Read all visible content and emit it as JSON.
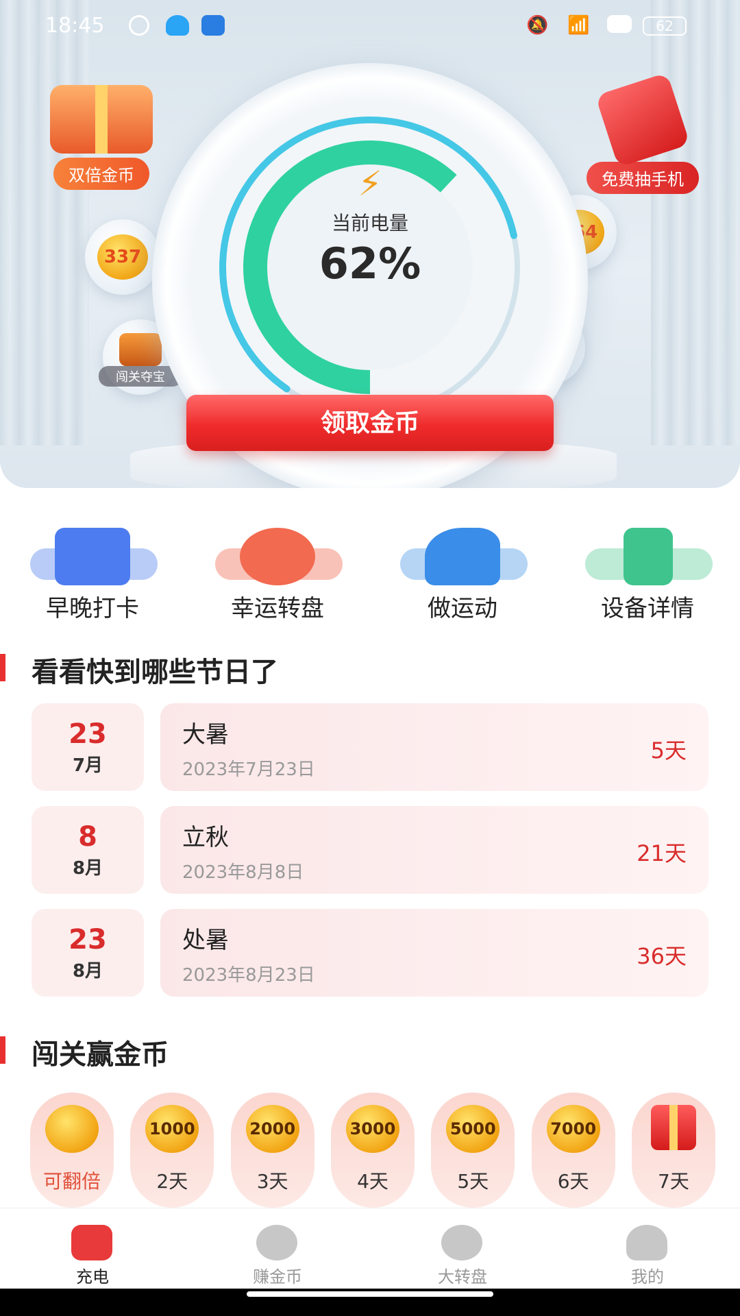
{
  "status_bar": {
    "time": "18:45",
    "battery": "62"
  },
  "hero": {
    "battery_label": "当前电量",
    "battery_percent": "62%",
    "battery_level": 0.62,
    "left_badge": "双倍金币",
    "right_badge": "免费抽手机",
    "coin_left": "337",
    "coin_right": "364",
    "chest_label": "闯关夺宝",
    "claim_button": "领取金币",
    "accent_color": "#e83030",
    "gauge_color": "#2fd1a0"
  },
  "actions": [
    {
      "label": "早晚打卡",
      "icon": "calendar-check-icon",
      "color": "#4d7cf0",
      "base": "#b9ccf7"
    },
    {
      "label": "幸运转盘",
      "icon": "lucky-wheel-icon",
      "color": "#f26a50",
      "base": "#f9c2b8"
    },
    {
      "label": "做运动",
      "icon": "sneaker-icon",
      "color": "#3a8de8",
      "base": "#b6d5f5"
    },
    {
      "label": "设备详情",
      "icon": "phone-device-icon",
      "color": "#3fc48e",
      "base": "#bdebd6"
    }
  ],
  "holidays_section": {
    "title": "看看快到哪些节日了",
    "items": [
      {
        "day": "23",
        "month": "7月",
        "name": "大暑",
        "date": "2023年7月23日",
        "countdown": "5天"
      },
      {
        "day": "8",
        "month": "8月",
        "name": "立秋",
        "date": "2023年8月8日",
        "countdown": "21天"
      },
      {
        "day": "23",
        "month": "8月",
        "name": "处暑",
        "date": "2023年8月23日",
        "countdown": "36天"
      }
    ]
  },
  "rewards_section": {
    "title": "闯关赢金币",
    "items": [
      {
        "coin": "",
        "label": "可翻倍"
      },
      {
        "coin": "1000",
        "label": "2天"
      },
      {
        "coin": "2000",
        "label": "3天"
      },
      {
        "coin": "3000",
        "label": "4天"
      },
      {
        "coin": "5000",
        "label": "5天"
      },
      {
        "coin": "7000",
        "label": "6天"
      },
      {
        "coin": "",
        "label": "7天"
      }
    ]
  },
  "bottom_nav": [
    {
      "label": "充电",
      "icon": "charge-icon",
      "active": true
    },
    {
      "label": "赚金币",
      "icon": "earn-coin-icon",
      "active": false
    },
    {
      "label": "大转盘",
      "icon": "spin-wheel-icon",
      "active": false
    },
    {
      "label": "我的",
      "icon": "profile-icon",
      "active": false
    }
  ]
}
